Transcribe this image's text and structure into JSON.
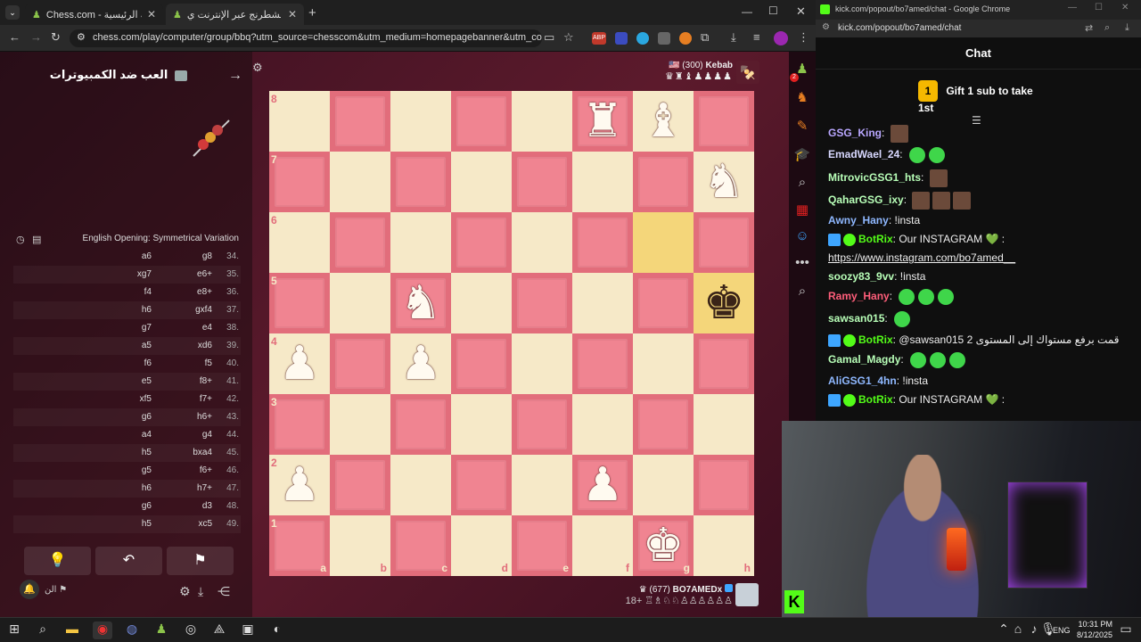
{
  "browser_left": {
    "tabs": [
      {
        "label": "Chess.com - الصفحة الرئيسية",
        "active": false
      },
      {
        "label": "العب الشطرنج عبر الإنترنت ي...",
        "active": true
      }
    ],
    "url": "chess.com/play/computer/group/bbq?utm_source=chesscom&utm_medium=homepagebanner&utm_content=bots_b..."
  },
  "chess": {
    "panel_title": "العب ضد الكمبيوترات",
    "opening": "English Opening: Symmetrical Variation",
    "moves": [
      {
        "n": "34.",
        "w": "g8",
        "b": "a6"
      },
      {
        "n": "35.",
        "w": "e6+",
        "b": "xg7"
      },
      {
        "n": "36.",
        "w": "e8+",
        "b": "f4"
      },
      {
        "n": "37.",
        "w": "gxf4",
        "b": "h6"
      },
      {
        "n": "38.",
        "w": "e4",
        "b": "g7"
      },
      {
        "n": "39.",
        "w": "xd6",
        "b": "a5"
      },
      {
        "n": "40.",
        "w": "f5",
        "b": "f6"
      },
      {
        "n": "41.",
        "w": "f8+",
        "b": "e5"
      },
      {
        "n": "42.",
        "w": "f7+",
        "b": "xf5"
      },
      {
        "n": "43.",
        "w": "h6+",
        "b": "g6"
      },
      {
        "n": "44.",
        "w": "g4",
        "b": "a4"
      },
      {
        "n": "45.",
        "w": "bxa4",
        "b": "h5"
      },
      {
        "n": "46.",
        "w": "f6+",
        "b": "g5"
      },
      {
        "n": "47.",
        "w": "h7+",
        "b": "h6"
      },
      {
        "n": "48.",
        "w": "d3",
        "b": "g6"
      },
      {
        "n": "49.",
        "w": "xc5",
        "b": "h5"
      }
    ],
    "top_player": {
      "rating": "(300)",
      "name": "Kebab"
    },
    "bottom_player": {
      "rating": "(677)",
      "name": "BO7AMEDx",
      "age": "18+"
    },
    "ranks": [
      "8",
      "7",
      "6",
      "5",
      "4",
      "3",
      "2",
      "1"
    ],
    "files": [
      "a",
      "b",
      "c",
      "d",
      "e",
      "f",
      "g",
      "h"
    ],
    "pieces": [
      {
        "sq": "f8",
        "glyph": "♜",
        "color": "white"
      },
      {
        "sq": "g8",
        "glyph": "♝",
        "color": "white"
      },
      {
        "sq": "h7",
        "glyph": "♞",
        "color": "white"
      },
      {
        "sq": "c5",
        "glyph": "♞",
        "color": "white"
      },
      {
        "sq": "h5",
        "glyph": "♚",
        "color": "black"
      },
      {
        "sq": "a4",
        "glyph": "♟",
        "color": "white"
      },
      {
        "sq": "c4",
        "glyph": "♟",
        "color": "white"
      },
      {
        "sq": "a2",
        "glyph": "♟",
        "color": "white"
      },
      {
        "sq": "f2",
        "glyph": "♟",
        "color": "white"
      },
      {
        "sq": "g1",
        "glyph": "♚",
        "color": "white"
      }
    ],
    "highlight": [
      "g6",
      "h5"
    ],
    "bottom_actions": [
      "flag-label"
    ],
    "bottom_label": "الن"
  },
  "browser_right": {
    "title": "kick.com/popout/bo7amed/chat - Google Chrome",
    "url": "kick.com/popout/bo7amed/chat"
  },
  "chat": {
    "header": "Chat",
    "gift_count": "1",
    "gift_text": "Gift 1 sub to take 1st",
    "messages": [
      {
        "user": "GSG_King",
        "color": "#b9a7ff",
        "text": "",
        "emotes": 1,
        "etype": "img"
      },
      {
        "user": "EmadWael_24",
        "color": "#d8d8ff",
        "text": "",
        "emotes": 2,
        "etype": "green"
      },
      {
        "user": "MitrovicGSG1_hts",
        "color": "#b8ffb8",
        "text": "",
        "emotes": 1,
        "etype": "img"
      },
      {
        "user": "QaharGSG_ixy",
        "color": "#b8ffb8",
        "text": "",
        "emotes": 3,
        "etype": "img"
      },
      {
        "user": "Awny_Hany",
        "color": "#8fb8ff",
        "text": "!insta",
        "emotes": 0
      },
      {
        "user": "BotRix",
        "color": "#53fc18",
        "text": "Our INSTAGRAM 💚 :",
        "emotes": 0,
        "bot": true
      },
      {
        "user": "",
        "color": "#fff",
        "text": "https://www.instagram.com/bo7amed__",
        "emotes": 0,
        "link": true
      },
      {
        "user": "soozy83_9vv",
        "color": "#b8ffb8",
        "text": "!insta",
        "emotes": 0
      },
      {
        "user": "Ramy_Hany",
        "color": "#ff5e7a",
        "text": "",
        "emotes": 3,
        "etype": "green"
      },
      {
        "user": "sawsan015",
        "color": "#b8ffb8",
        "text": "",
        "emotes": 1,
        "etype": "green"
      },
      {
        "user": "BotRix",
        "color": "#53fc18",
        "text": "@sawsan015 قمت برفع مستواك إلى المستوى 2",
        "emotes": 0,
        "bot": true
      },
      {
        "user": "Gamal_Magdy",
        "color": "#b8ffb8",
        "text": "",
        "emotes": 3,
        "etype": "green"
      },
      {
        "user": "AliGSG1_4hn",
        "color": "#8fb8ff",
        "text": "!insta",
        "emotes": 0
      },
      {
        "user": "BotRix",
        "color": "#53fc18",
        "text": "Our INSTAGRAM 💚 :",
        "emotes": 0,
        "bot": true
      }
    ]
  },
  "taskbar": {
    "lang": "ENG",
    "time": "10:31 PM",
    "date": "8/12/2025"
  }
}
